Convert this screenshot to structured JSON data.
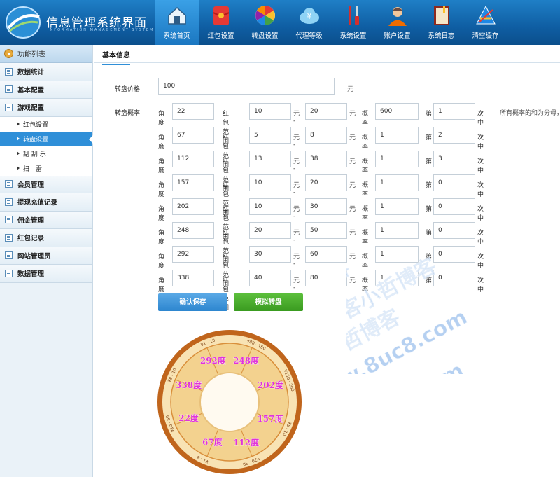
{
  "header": {
    "title": "信息管理系统界面",
    "subtitle": "INFORMATION MANAGEMENT SYSTEM GUI",
    "nav": [
      {
        "label": "系统首页",
        "icon": "home-icon",
        "active": true
      },
      {
        "label": "红包设置",
        "icon": "red-envelope-icon",
        "active": false
      },
      {
        "label": "转盘设置",
        "icon": "wheel-icon",
        "active": false
      },
      {
        "label": "代理等级",
        "icon": "money-cloud-icon",
        "active": false
      },
      {
        "label": "系统设置",
        "icon": "tools-icon",
        "active": false
      },
      {
        "label": "账户设置",
        "icon": "user-icon",
        "active": false
      },
      {
        "label": "系统日志",
        "icon": "book-icon",
        "active": false
      },
      {
        "label": "清空缓存",
        "icon": "clear-cache-icon",
        "active": false
      }
    ]
  },
  "sidebar": {
    "header": "功能列表",
    "items": [
      {
        "label": "数据统计"
      },
      {
        "label": "基本配置"
      },
      {
        "label": "游戏配置"
      }
    ],
    "sub_items": [
      {
        "label": "红包设置",
        "active": false
      },
      {
        "label": "转盘设置",
        "active": true
      },
      {
        "label": "刮 刮 乐",
        "active": false
      },
      {
        "label": "扫　雷",
        "active": false
      }
    ],
    "items_after": [
      {
        "label": "会员管理"
      },
      {
        "label": "提现充值记录"
      },
      {
        "label": "佣金管理"
      },
      {
        "label": "红包记录"
      },
      {
        "label": "网站管理员"
      },
      {
        "label": "数据管理"
      }
    ]
  },
  "main": {
    "tab": "基本信息",
    "price_label": "转盘价格",
    "price_value": "100",
    "price_unit": "元",
    "prob_label": "转盘概率",
    "col_labels": {
      "angle": "角度",
      "range": "红包范围",
      "to": "元 -",
      "yuan": "元",
      "prob": "概率",
      "nth": "第",
      "hit": "次中"
    },
    "note": "所有概率的和为分母，",
    "rows": [
      {
        "angle": "22",
        "min": "10",
        "max": "20",
        "prob": "600",
        "nth": "1"
      },
      {
        "angle": "67",
        "min": "5",
        "max": "8",
        "prob": "1",
        "nth": "2"
      },
      {
        "angle": "112",
        "min": "13",
        "max": "38",
        "prob": "1",
        "nth": "3"
      },
      {
        "angle": "157",
        "min": "10",
        "max": "20",
        "prob": "1",
        "nth": "0"
      },
      {
        "angle": "202",
        "min": "10",
        "max": "30",
        "prob": "1",
        "nth": "0"
      },
      {
        "angle": "248",
        "min": "20",
        "max": "50",
        "prob": "1",
        "nth": "0"
      },
      {
        "angle": "292",
        "min": "30",
        "max": "60",
        "prob": "1",
        "nth": "0"
      },
      {
        "angle": "338",
        "min": "40",
        "max": "80",
        "prob": "1",
        "nth": "0"
      }
    ],
    "save_label": "确认保存",
    "simulate_label": "模拟转盘"
  },
  "wheel": {
    "segment_labels": [
      "22度",
      "67度",
      "112度",
      "157度",
      "202度",
      "248度",
      "292度",
      "338度"
    ],
    "rim_labels": [
      "¥1 - 10",
      "¥80 - 150",
      "¥150 - 200",
      "¥5 - 10",
      "¥20 - 30",
      "¥1 - 8",
      "¥10 - 50",
      "¥8 - 10"
    ],
    "colors": {
      "rim": "#c0651c",
      "ring": "#f3d28f",
      "label": "#e034d8"
    }
  },
  "watermark": {
    "lines": [
      "小哲博客",
      "小哲博客小哲博客",
      "哲博客小哲博客",
      "www.8uc8.com",
      "www.8uc8.com"
    ]
  }
}
